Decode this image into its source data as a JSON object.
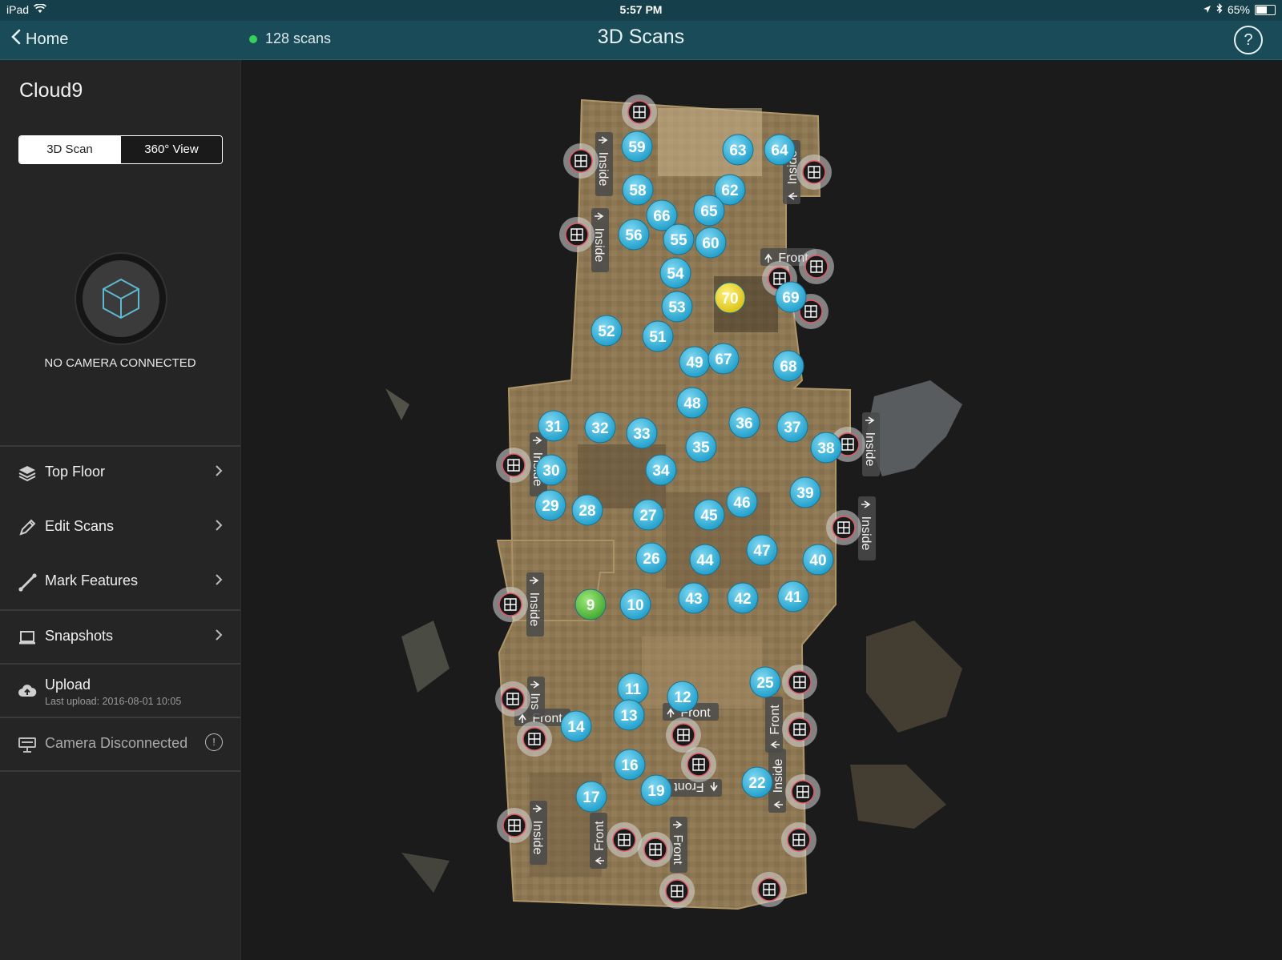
{
  "status_bar": {
    "device": "iPad",
    "time": "5:57 PM",
    "battery": "65%",
    "battery_level": 0.65
  },
  "nav": {
    "back_label": "Home",
    "scan_count": "128 scans",
    "title": "3D Scans",
    "help_glyph": "?"
  },
  "sidebar": {
    "project_name": "Cloud9",
    "toggle": {
      "left": "3D Scan",
      "right": "360° View",
      "active": "3D Scan"
    },
    "camera_status": "NO CAMERA CONNECTED",
    "menu": [
      {
        "label": "Top Floor",
        "icon": "layers-icon"
      },
      {
        "label": "Edit Scans",
        "icon": "pencil-icon"
      },
      {
        "label": "Mark Features",
        "icon": "ruler-icon"
      },
      {
        "label": "Snapshots",
        "icon": "laptop-icon"
      }
    ],
    "upload": {
      "label": "Upload",
      "sub": "Last upload: 2016-08-01 10:05",
      "icon": "cloud-upload-icon"
    },
    "camera_item": {
      "label": "Camera Disconnected",
      "icon": "camera-icon"
    }
  },
  "map": {
    "scans": [
      "59",
      "63",
      "64",
      "58",
      "62",
      "66",
      "65",
      "56",
      "55",
      "60",
      "54",
      "53",
      "70",
      "69",
      "52",
      "51",
      "49",
      "67",
      "68",
      "48",
      "31",
      "32",
      "33",
      "36",
      "37",
      "38",
      "35",
      "30",
      "34",
      "39",
      "29",
      "28",
      "27",
      "45",
      "46",
      "47",
      "40",
      "26",
      "44",
      "9",
      "10",
      "43",
      "42",
      "41",
      "11",
      "12",
      "25",
      "13",
      "14",
      "16",
      "22",
      "19",
      "17"
    ],
    "highlight": {
      "yellow": "70",
      "green": "9"
    },
    "markers": [
      {
        "text": "Front"
      },
      {
        "text": "Front"
      },
      {
        "text": "Front"
      },
      {
        "text": "Front"
      },
      {
        "text": "Front"
      },
      {
        "text": "Front"
      },
      {
        "text": "Front"
      },
      {
        "text": "Inside"
      },
      {
        "text": "Inside"
      },
      {
        "text": "Inside"
      },
      {
        "text": "Inside"
      },
      {
        "text": "Inside"
      },
      {
        "text": "Inside"
      },
      {
        "text": "Inside"
      },
      {
        "text": "Inside"
      },
      {
        "text": "Inside"
      },
      {
        "text": "Ins"
      }
    ]
  },
  "colors": {
    "navbar": "#1a4b58",
    "statusbar": "#15404b",
    "scan_pin": "#29aedb",
    "yellow_pin": "#e6d21a",
    "green_pin": "#4cb83a",
    "floor": "#8a7553"
  }
}
